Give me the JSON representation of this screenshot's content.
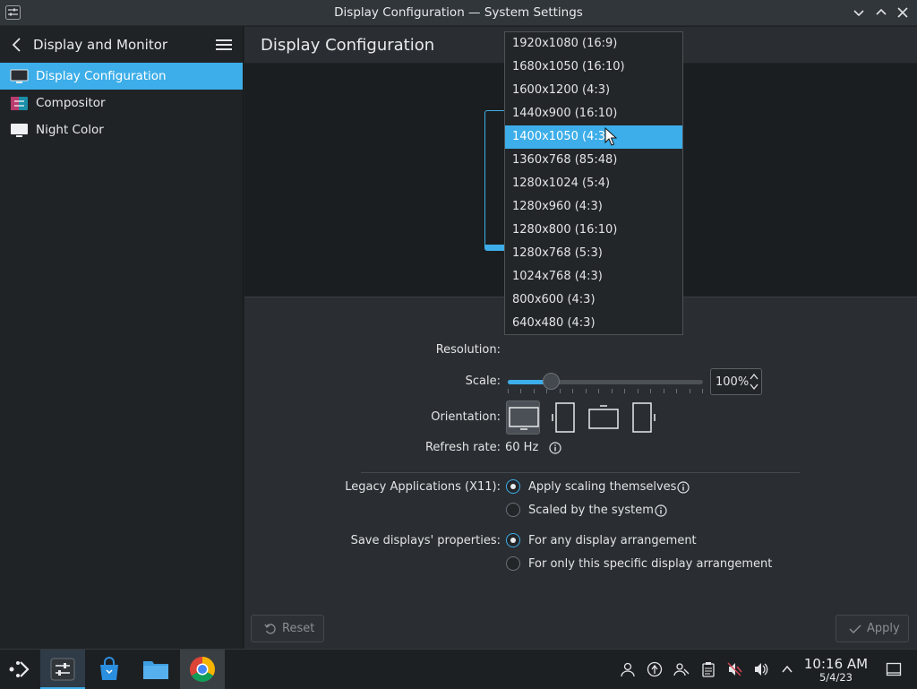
{
  "window": {
    "title": "Display Configuration — System Settings"
  },
  "sidebar": {
    "header": "Display and Monitor",
    "items": [
      {
        "label": "Display Configuration",
        "icon": "monitor-icon",
        "active": true
      },
      {
        "label": "Compositor",
        "icon": "compositor-icon",
        "active": false
      },
      {
        "label": "Night Color",
        "icon": "night-color-icon",
        "active": false
      }
    ]
  },
  "main": {
    "title": "Display Configuration",
    "labels": {
      "resolution": "Resolution:",
      "scale": "Scale:",
      "orientation": "Orientation:",
      "refresh_rate": "Refresh rate:",
      "refresh_value": "60 Hz",
      "legacy": "Legacy Applications (X11):",
      "save": "Save displays' properties:"
    },
    "scale": {
      "value": "100%",
      "slider_fraction": 0.22
    },
    "legacy_options": [
      "Apply scaling themselves",
      "Scaled by the system"
    ],
    "save_options": [
      "For any display arrangement",
      "For only this specific display arrangement"
    ],
    "reset_label": "Reset",
    "apply_label": "Apply"
  },
  "resolution_dropdown": {
    "selected_index": 4,
    "options": [
      "1920x1080 (16:9)",
      "1680x1050 (16:10)",
      "1600x1200 (4:3)",
      "1440x900 (16:10)",
      "1400x1050 (4:3)",
      "1360x768 (85:48)",
      "1280x1024 (5:4)",
      "1280x960 (4:3)",
      "1280x800 (16:10)",
      "1280x768 (5:3)",
      "1024x768 (4:3)",
      "800x600 (4:3)",
      "640x480 (4:3)"
    ]
  },
  "taskbar": {
    "time": "10:16 AM",
    "date": "5/4/23"
  },
  "colors": {
    "accent": "#3daee9",
    "background": "#2a2e32",
    "sidebar": "#202326"
  }
}
